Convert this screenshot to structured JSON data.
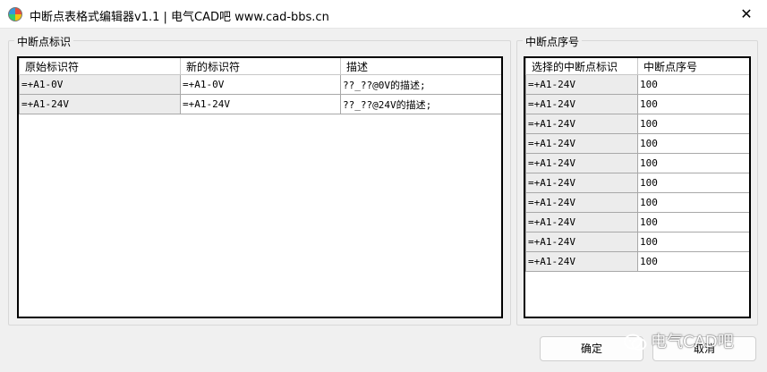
{
  "window": {
    "title": "中断点表格式编辑器v1.1 | 电气CAD吧 www.cad-bbs.cn",
    "close_symbol": "✕"
  },
  "left_group": {
    "title": "中断点标识",
    "columns": [
      "原始标识符",
      "新的标识符",
      "描述"
    ],
    "rows": [
      [
        "=+A1-0V",
        "=+A1-0V",
        "??_??@0V的描述;"
      ],
      [
        "=+A1-24V",
        "=+A1-24V",
        "??_??@24V的描述;"
      ]
    ]
  },
  "right_group": {
    "title": "中断点序号",
    "columns": [
      "选择的中断点标识",
      "中断点序号"
    ],
    "rows": [
      [
        "=+A1-24V",
        "100"
      ],
      [
        "=+A1-24V",
        "100"
      ],
      [
        "=+A1-24V",
        "100"
      ],
      [
        "=+A1-24V",
        "100"
      ],
      [
        "=+A1-24V",
        "100"
      ],
      [
        "=+A1-24V",
        "100"
      ],
      [
        "=+A1-24V",
        "100"
      ],
      [
        "=+A1-24V",
        "100"
      ],
      [
        "=+A1-24V",
        "100"
      ],
      [
        "=+A1-24V",
        "100"
      ]
    ]
  },
  "buttons": {
    "ok": "确定",
    "cancel": "取消"
  },
  "watermark": {
    "text": "电气CAD吧"
  }
}
